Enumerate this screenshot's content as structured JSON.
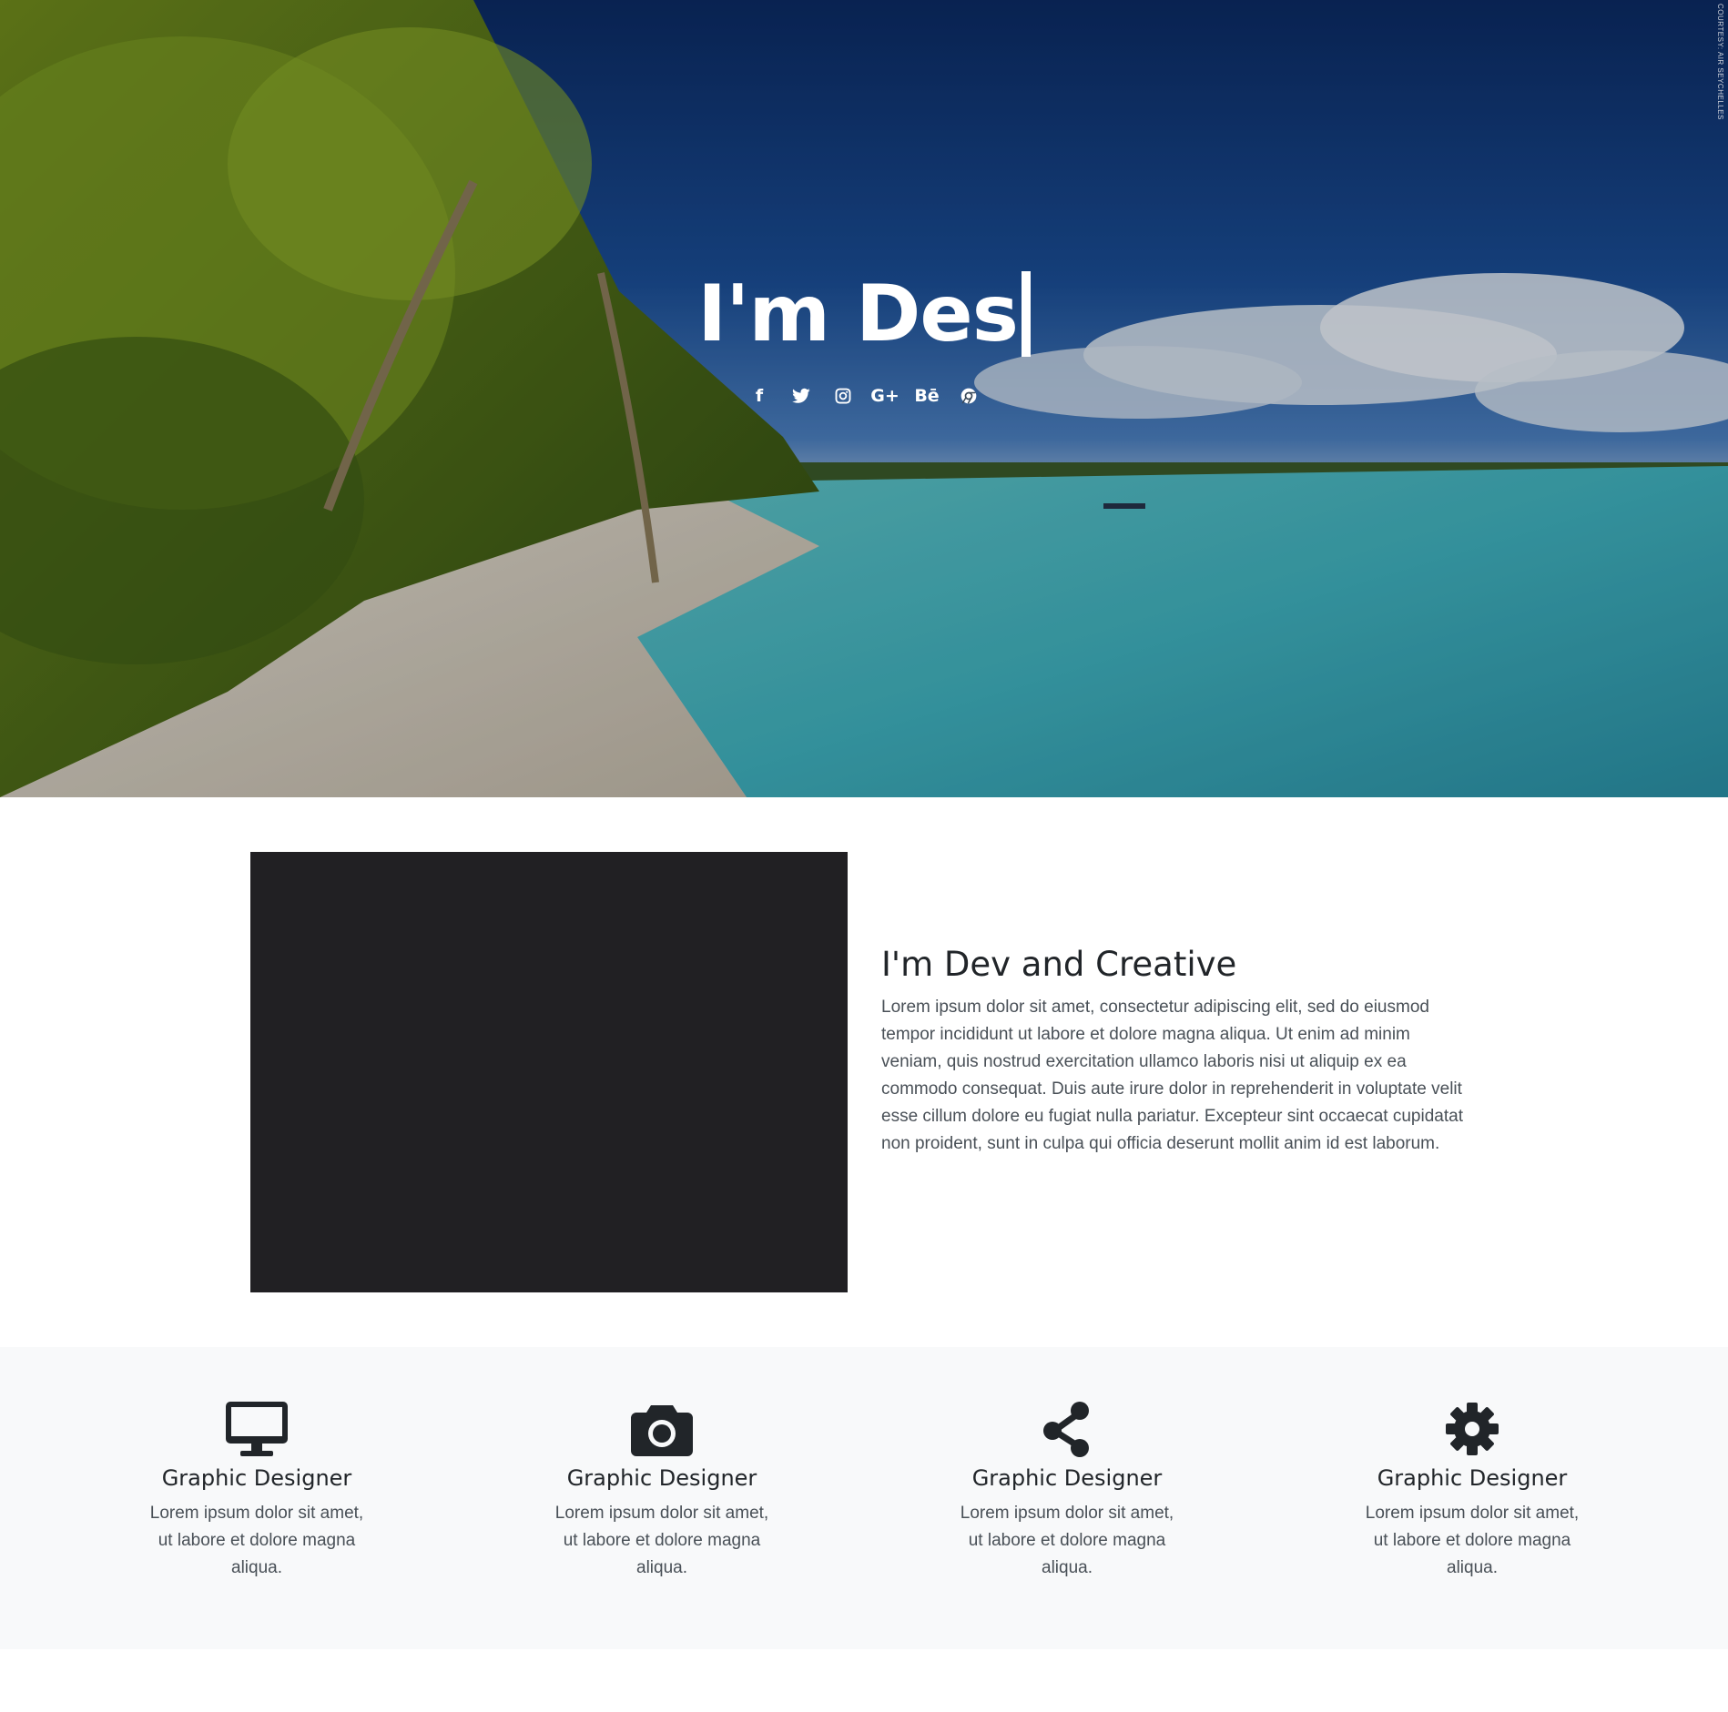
{
  "hero": {
    "title": "I'm Des",
    "credit": "COURTESY: AIR SEYCHELLES",
    "social": [
      {
        "icon": "facebook-icon",
        "glyph": "f"
      },
      {
        "icon": "twitter-icon",
        "glyph": ""
      },
      {
        "icon": "instagram-icon",
        "glyph": ""
      },
      {
        "icon": "google-plus-icon",
        "glyph": "G+"
      },
      {
        "icon": "behance-icon",
        "glyph": "Bē"
      },
      {
        "icon": "chrome-icon",
        "glyph": ""
      }
    ]
  },
  "about": {
    "title": "I'm Dev and Creative",
    "body": "Lorem ipsum dolor sit amet, consectetur adipiscing elit, sed do eiusmod tempor incididunt ut labore et dolore magna aliqua. Ut enim ad minim veniam, quis nostrud exercitation ullamco laboris nisi ut aliquip ex ea commodo consequat. Duis aute irure dolor in reprehenderit in voluptate velit esse cillum dolore eu fugiat nulla pariatur. Excepteur sint occaecat cupidatat non proident, sunt in culpa qui officia deserunt mollit anim id est laborum."
  },
  "services": [
    {
      "icon": "desktop-icon",
      "title": "Graphic Designer",
      "text": "Lorem ipsum dolor sit amet, ut labore et dolore magna aliqua."
    },
    {
      "icon": "camera-icon",
      "title": "Graphic Designer",
      "text": "Lorem ipsum dolor sit amet, ut labore et dolore magna aliqua."
    },
    {
      "icon": "share-icon",
      "title": "Graphic Designer",
      "text": "Lorem ipsum dolor sit amet, ut labore et dolore magna aliqua."
    },
    {
      "icon": "gear-icon",
      "title": "Graphic Designer",
      "text": "Lorem ipsum dolor sit amet, ut labore et dolore magna aliqua."
    }
  ],
  "colors": {
    "text_dark": "#212529",
    "text_body": "#495057",
    "services_bg": "#f8f9fa",
    "about_image": "#212023"
  }
}
